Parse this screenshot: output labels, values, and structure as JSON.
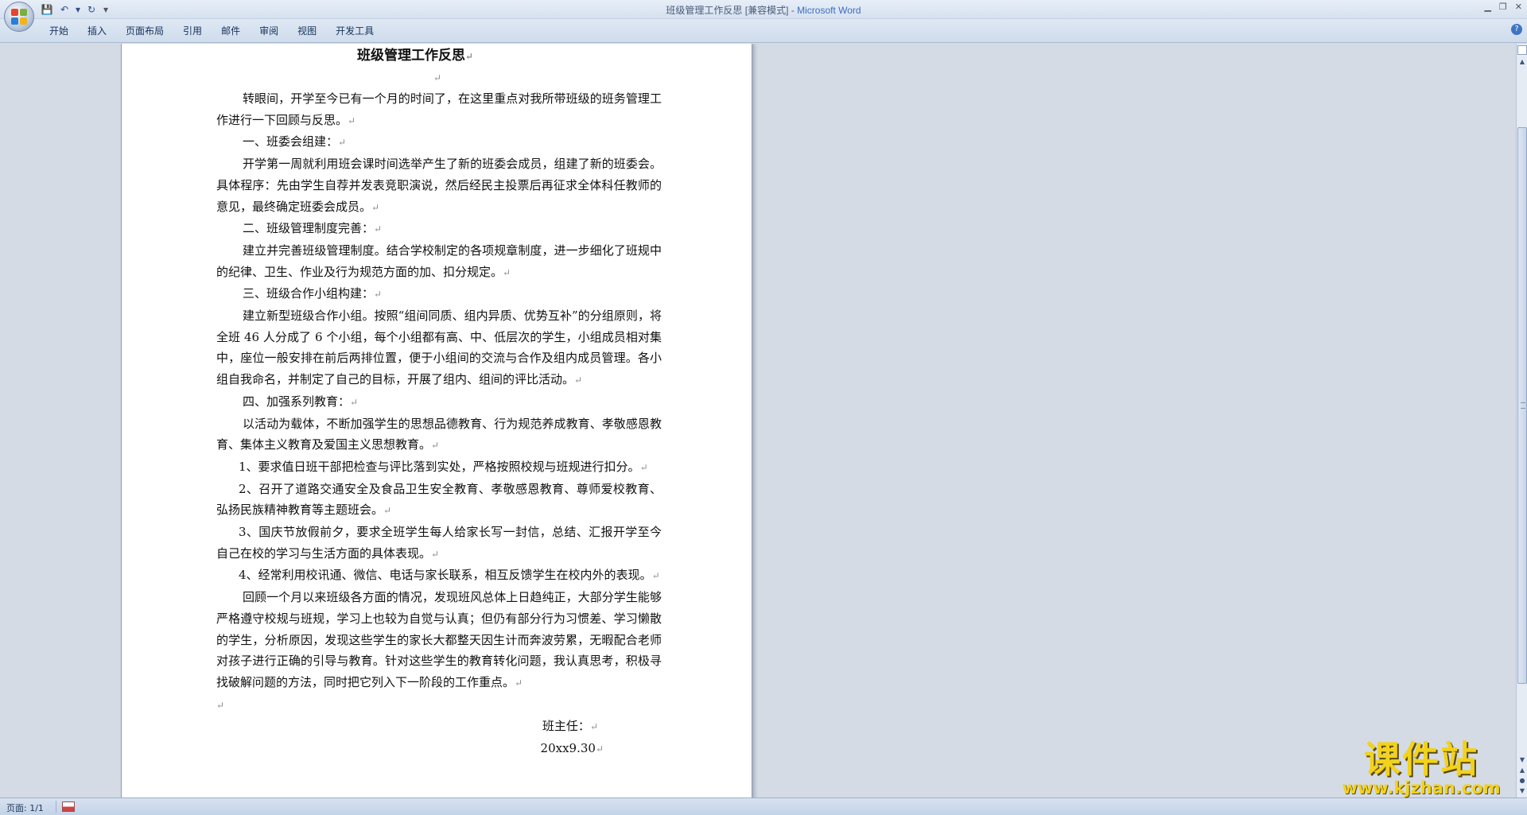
{
  "window": {
    "title": "班级管理工作反思 [兼容模式]",
    "separator": " - ",
    "app": "Microsoft Word",
    "minimize": "▁",
    "restore": "❐",
    "close": "✕"
  },
  "quick_access": {
    "save": "💾",
    "undo": "↶",
    "undo_dropdown": "▾",
    "redo": "↻",
    "customize": "▾"
  },
  "ribbon": {
    "tabs": [
      "开始",
      "插入",
      "页面布局",
      "引用",
      "邮件",
      "审阅",
      "视图",
      "开发工具"
    ],
    "help": "?"
  },
  "document": {
    "title": "班级管理工作反思",
    "paragraph_mark": "↵",
    "paragraphs": [
      {
        "text": "转眼间，开学至今已有一个月的时间了，在这里重点对我所带班级的班务管理工作进行一下回顾与反思。",
        "style": "p"
      },
      {
        "text": "一、班委会组建：",
        "style": "p"
      },
      {
        "text": "开学第一周就利用班会课时间选举产生了新的班委会成员，组建了新的班委会。具体程序：先由学生自荐并发表竞职演说，然后经民主投票后再征求全体科任教师的意见，最终确定班委会成员。",
        "style": "p"
      },
      {
        "text": "二、班级管理制度完善：",
        "style": "p"
      },
      {
        "text": "建立并完善班级管理制度。结合学校制定的各项规章制度，进一步细化了班规中的纪律、卫生、作业及行为规范方面的加、扣分规定。",
        "style": "p"
      },
      {
        "text": "三、班级合作小组构建：",
        "style": "p"
      },
      {
        "text": "建立新型班级合作小组。按照“组间同质、组内异质、优势互补”的分组原则，将全班 46 人分成了 6 个小组，每个小组都有高、中、低层次的学生，小组成员相对集中，座位一般安排在前后两排位置，便于小组间的交流与合作及组内成员管理。各小组自我命名，并制定了自己的目标，开展了组内、组间的评比活动。",
        "style": "p"
      },
      {
        "text": "四、加强系列教育：",
        "style": "p"
      },
      {
        "text": "以活动为载体，不断加强学生的思想品德教育、行为规范养成教育、孝敬感恩教育、集体主义教育及爱国主义思想教育。",
        "style": "p"
      },
      {
        "text": "1、要求值日班干部把检查与评比落到实处，严格按照校规与班规进行扣分。",
        "style": "sub"
      },
      {
        "text": "2、召开了道路交通安全及食品卫生安全教育、孝敬感恩教育、尊师爱校教育、弘扬民族精神教育等主题班会。",
        "style": "sub"
      },
      {
        "text": "3、国庆节放假前夕，要求全班学生每人给家长写一封信，总结、汇报开学至今自己在校的学习与生活方面的具体表现。",
        "style": "sub"
      },
      {
        "text": "4、经常利用校讯通、微信、电话与家长联系，相互反馈学生在校内外的表现。",
        "style": "sub"
      },
      {
        "text": "回顾一个月以来班级各方面的情况，发现班风总体上日趋纯正，大部分学生能够严格遵守校规与班规，学习上也较为自觉与认真；但仍有部分行为习惯差、学习懒散的学生，分析原因，发现这些学生的家长大都整天因生计而奔波劳累，无暇配合老师对孩子进行正确的引导与教育。针对这些学生的教育转化问题，我认真思考，积极寻找破解问题的方法，同时把它列入下一阶段的工作重点。",
        "style": "p"
      },
      {
        "text": "",
        "style": "noind"
      }
    ],
    "signature": "班主任：",
    "date": "20xx9.30"
  },
  "scrollbar": {
    "up": "▲",
    "down": "▼",
    "prev_page": "▲",
    "select_browse": "●",
    "next_page": "▼"
  },
  "status": {
    "page": "页面: 1/1"
  },
  "watermark": {
    "text": "课件站",
    "url": "www.kjzhan.com"
  },
  "colors": {
    "title_app": "#3a6fc2",
    "page_bg": "#ffffff",
    "workspace_bg": "#d4dbe5",
    "watermark": "#f2d21b"
  }
}
